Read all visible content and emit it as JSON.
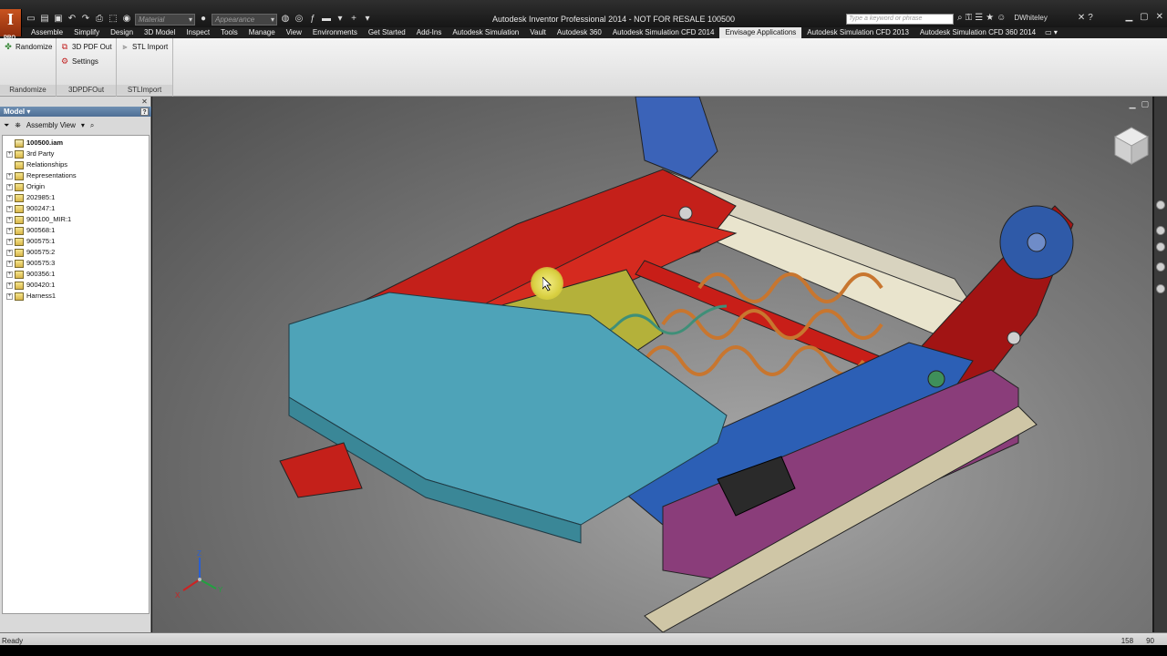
{
  "titlebar": {
    "app_logo": "I",
    "app_logo_sub": "PRO",
    "title": "Autodesk Inventor Professional 2014 - NOT FOR RESALE   100500",
    "material_placeholder": "Material",
    "appearance_placeholder": "Appearance",
    "search_placeholder": "Type a keyword or phrase",
    "user": "DWhiteley"
  },
  "ribbon_tabs": [
    "Assemble",
    "Simplify",
    "Design",
    "3D Model",
    "Inspect",
    "Tools",
    "Manage",
    "View",
    "Environments",
    "Get Started",
    "Add-Ins",
    "Autodesk Simulation",
    "Vault",
    "Autodesk 360",
    "Autodesk Simulation CFD 2014",
    "Envisage Applications",
    "Autodesk Simulation CFD 2013",
    "Autodesk Simulation CFD 360 2014"
  ],
  "active_tab": "Envisage Applications",
  "ribbon_panels": {
    "randomize": {
      "button": "Randomize",
      "title": "Randomize"
    },
    "pdf": {
      "button": "3D PDF Out",
      "settings": "Settings",
      "title": "3DPDFOut"
    },
    "stl": {
      "button": "STL Import",
      "title": "STLImport"
    }
  },
  "browser": {
    "header": "Model",
    "view_mode": "Assembly View",
    "tree": [
      {
        "label": "100500.iam",
        "root": true,
        "expandable": false
      },
      {
        "label": "3rd Party",
        "expandable": true
      },
      {
        "label": "Relationships",
        "expandable": false
      },
      {
        "label": "Representations",
        "expandable": true
      },
      {
        "label": "Origin",
        "expandable": true
      },
      {
        "label": "202985:1",
        "expandable": true
      },
      {
        "label": "900247:1",
        "expandable": true
      },
      {
        "label": "900100_MIR:1",
        "expandable": true
      },
      {
        "label": "900568:1",
        "expandable": true
      },
      {
        "label": "900575:1",
        "expandable": true
      },
      {
        "label": "900575:2",
        "expandable": true
      },
      {
        "label": "900575:3",
        "expandable": true
      },
      {
        "label": "900356:1",
        "expandable": true
      },
      {
        "label": "900420:1",
        "expandable": true
      },
      {
        "label": "Harness1",
        "expandable": true
      }
    ]
  },
  "triad": {
    "x": "X",
    "y": "Y",
    "z": "Z"
  },
  "status": {
    "text": "Ready",
    "count_a": "158",
    "count_b": "90"
  },
  "colors": {
    "accent_blue": "#4d6e95",
    "part_red": "#c4201a",
    "part_blue": "#2c5fb5",
    "part_cyan": "#4ea3b8",
    "part_orange": "#c8762f",
    "part_magenta": "#8a3d7a"
  }
}
